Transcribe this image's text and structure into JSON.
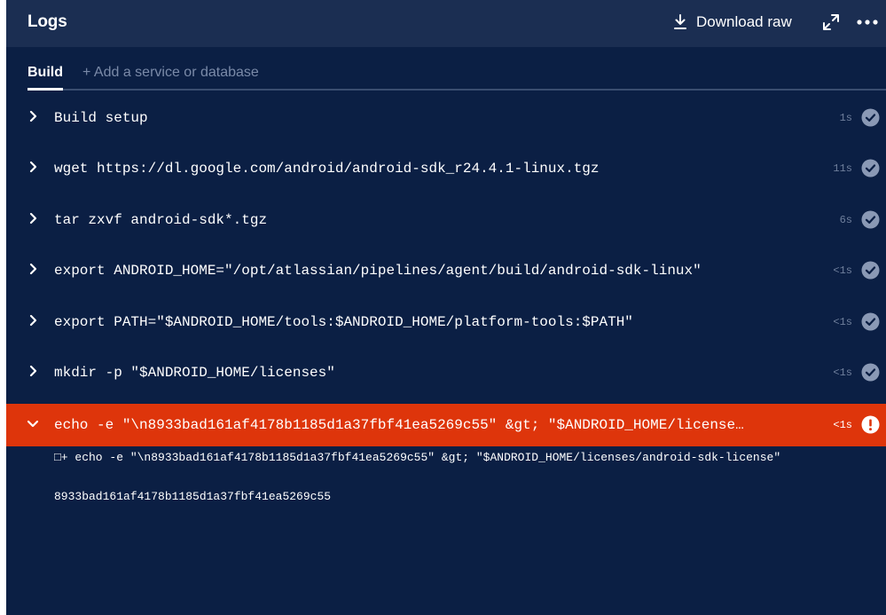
{
  "header": {
    "title": "Logs",
    "download_label": "Download raw"
  },
  "tabs": {
    "active": "Build",
    "add": "+ Add a service or database"
  },
  "steps": [
    {
      "command": "Build setup",
      "duration": "1s",
      "status": "success"
    },
    {
      "command": "wget https://dl.google.com/android/android-sdk_r24.4.1-linux.tgz",
      "duration": "11s",
      "status": "success"
    },
    {
      "command": "tar zxvf android-sdk*.tgz",
      "duration": "6s",
      "status": "success"
    },
    {
      "command": "export ANDROID_HOME=\"/opt/atlassian/pipelines/agent/build/android-sdk-linux\"",
      "duration": "<1s",
      "status": "success"
    },
    {
      "command": "export PATH=\"$ANDROID_HOME/tools:$ANDROID_HOME/platform-tools:$PATH\"",
      "duration": "<1s",
      "status": "success"
    },
    {
      "command": "mkdir -p \"$ANDROID_HOME/licenses\"",
      "duration": "<1s",
      "status": "success"
    },
    {
      "command": "echo -e \"\\n8933bad161af4178b1185d1a37fbf41ea5269c55\" &gt; \"$ANDROID_HOME/license…",
      "duration": "<1s",
      "status": "failed"
    }
  ],
  "output_lines": [
    "□+ echo -e \"\\n8933bad161af4178b1185d1a37fbf41ea5269c55\" &gt; \"$ANDROID_HOME/licenses/android-sdk-license\"",
    "8933bad161af4178b1185d1a37fbf41ea5269c55"
  ],
  "colors": {
    "panel_bg": "#0b1f44",
    "header_bg": "#1b2e52",
    "failed_bg": "#de350b",
    "success_icon": "#8a99b5"
  },
  "icons": {
    "download": "download-icon",
    "expand": "expand-icon",
    "more": "more-icon",
    "collapsed": "chevron-right-icon",
    "expanded": "chevron-down-icon",
    "success": "check-circle-icon",
    "failed": "error-circle-icon"
  }
}
